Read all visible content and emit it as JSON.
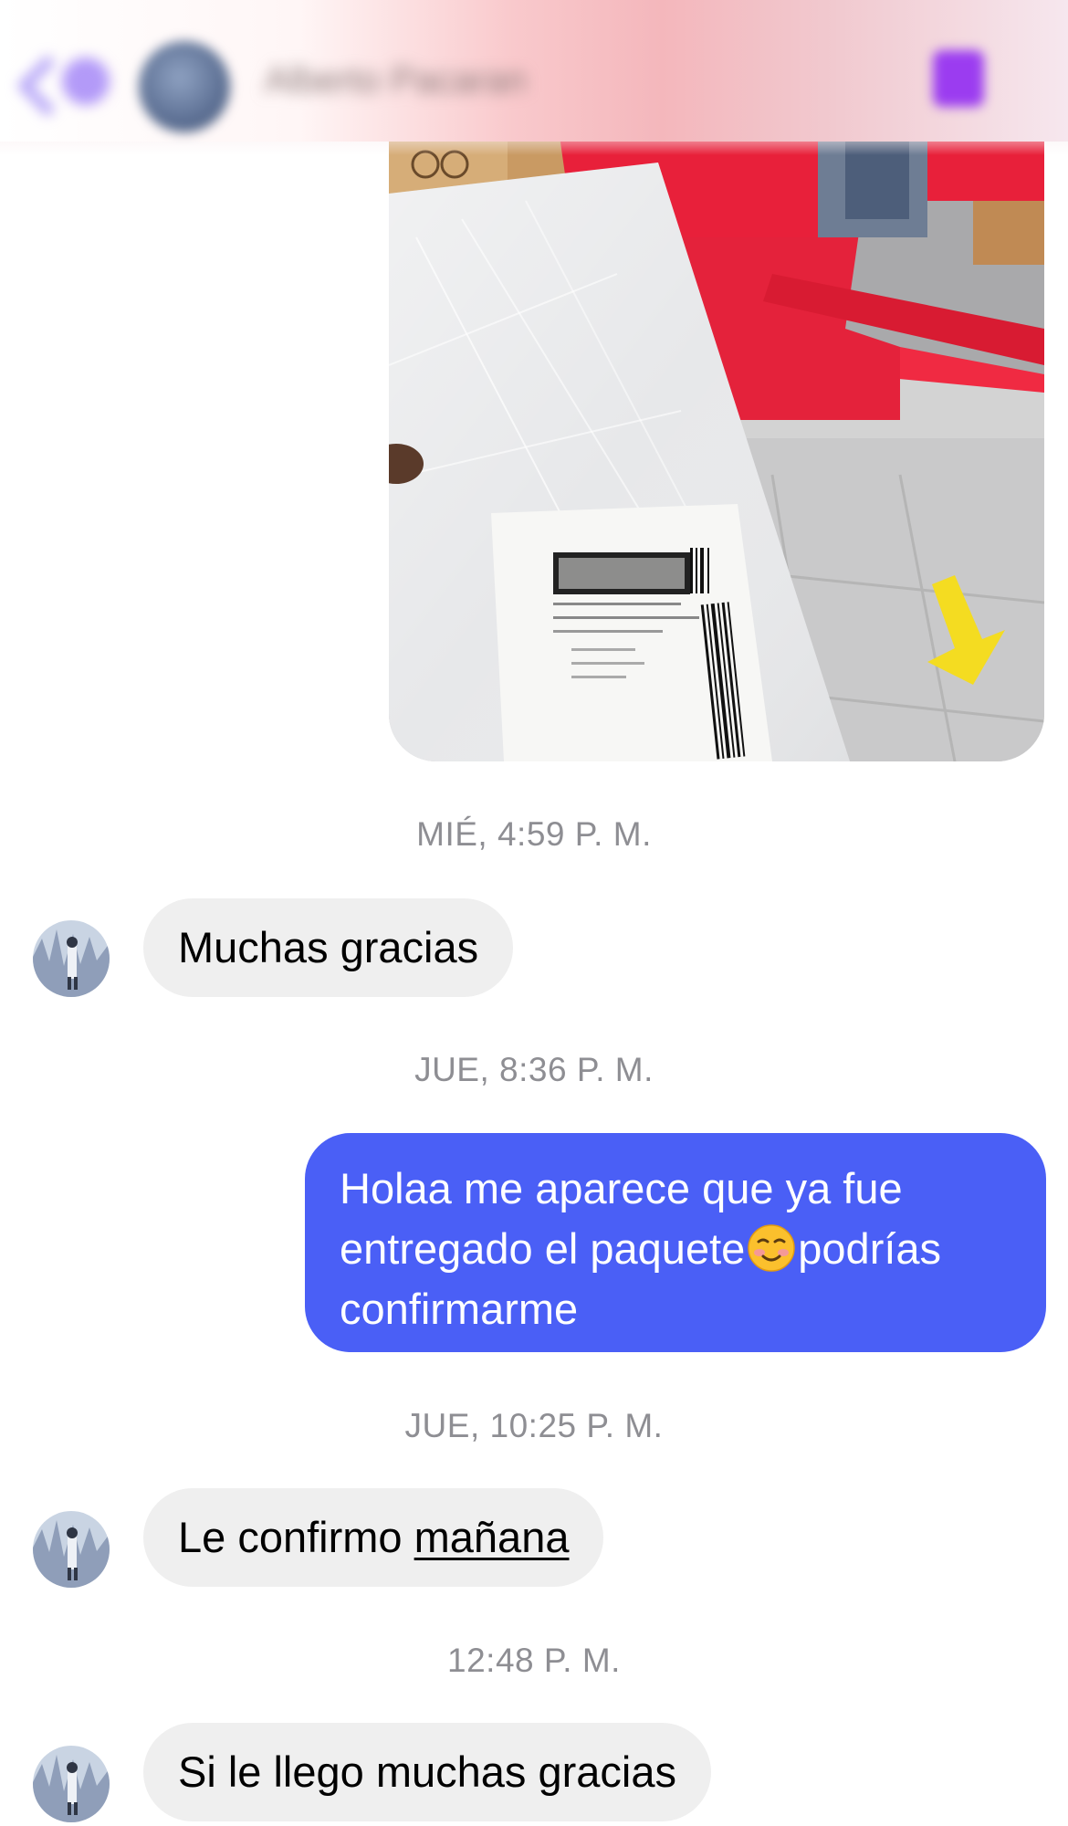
{
  "header": {
    "contact_name": "Alberto Pacaran",
    "back_icon": "chevron-left-icon",
    "action_icon": "shopping-bag-icon"
  },
  "messages": {
    "photo": {
      "description_icon": "package-photo"
    },
    "ts1": "MIÉ, 4:59 P. M.",
    "msg1": "Muchas gracias",
    "ts2": "JUE, 8:36 P. M.",
    "msg2_part1": "Holaa me aparece que ya fue",
    "msg2_part2": "entregado el paquete",
    "msg2_emoji": "☺️",
    "msg2_part3": "podrías",
    "msg2_part4": "confirmarme",
    "ts3": "JUE, 10:25 P. M.",
    "msg3_prefix": "Le confirmo ",
    "msg3_link": "mañana",
    "ts4": "12:48 P. M.",
    "msg4": "Si le llego muchas gracias"
  },
  "colors": {
    "outgoing_bubble": "#4a5ff6",
    "incoming_bubble": "#efefef",
    "timestamp": "#8e8e93"
  }
}
